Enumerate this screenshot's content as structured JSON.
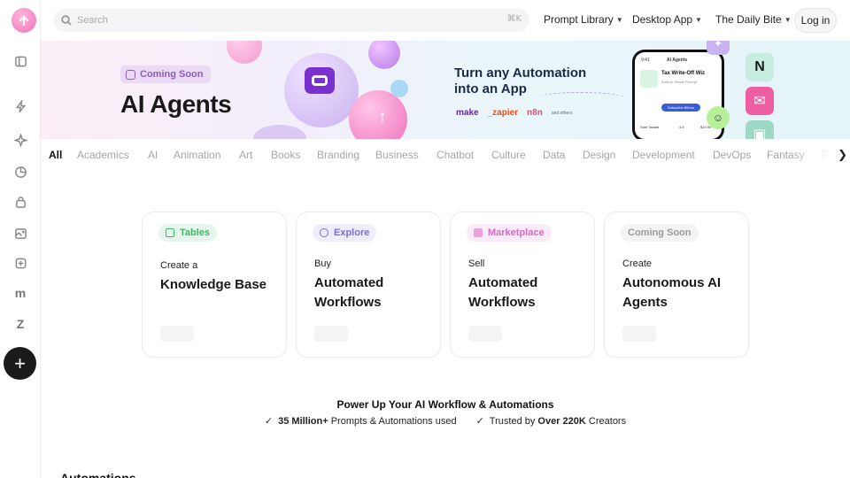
{
  "search": {
    "placeholder": "Search",
    "shortcut": "⌘K"
  },
  "nav": {
    "prompt_library": "Prompt Library",
    "desktop_app": "Desktop App",
    "daily_bite": "The Daily Bite",
    "login": "Log in"
  },
  "sidebar": {
    "items": [
      {
        "icon": "sidebar-panel-icon"
      },
      {
        "icon": "lightning-icon"
      },
      {
        "icon": "sparkle-icon"
      },
      {
        "icon": "chart-pie-icon"
      },
      {
        "icon": "bag-icon"
      },
      {
        "icon": "image-plus-icon"
      },
      {
        "icon": "plugin-icon"
      },
      {
        "icon": "make-logo-icon",
        "text": "m"
      },
      {
        "icon": "zapier-logo-icon",
        "text": "Z"
      }
    ],
    "add_label": "+"
  },
  "banner": {
    "badge": "Coming Soon",
    "title": "AI Agents",
    "headline": "Turn any Automation into an App",
    "brands": [
      "make",
      "_zapier",
      "n8n",
      "and others"
    ],
    "phone": {
      "app": "AI Agents",
      "time": "9:41",
      "item_title": "Tax Write-Off Wiz",
      "item_sub": "Built on Shane Prompt",
      "cta": "Subscribe $9/mo",
      "author": "Sam Tabata",
      "rating": "4.8",
      "price": "$19.9k"
    },
    "colors": {
      "accent": "#8e5cb8"
    }
  },
  "categories": [
    "All",
    "Academics",
    "AI",
    "Animation",
    "Art",
    "Books",
    "Branding",
    "Business",
    "Chatbot",
    "Culture",
    "Data",
    "Design",
    "Development",
    "DevOps",
    "Fantasy",
    "Fo"
  ],
  "cards": [
    {
      "badge": "Tables",
      "badge_color": "#3fb86a",
      "badge_bg": "#e6f6ec",
      "verb": "Create a",
      "object": "Knowledge Base"
    },
    {
      "badge": "Explore",
      "badge_color": "#7b6fd0",
      "badge_bg": "#efedfb",
      "verb": "Buy",
      "object": "Automated Workflows"
    },
    {
      "badge": "Marketplace",
      "badge_color": "#d36bc7",
      "badge_bg": "#fbeaf7",
      "verb": "Sell",
      "object": "Automated Workflows"
    },
    {
      "badge": "Coming Soon",
      "badge_color": "#9a9a9a",
      "badge_bg": "#f3f3f3",
      "verb": "Create",
      "object": "Autonomous AI Agents"
    }
  ],
  "power": {
    "title": "Power Up Your AI Workflow & Automations",
    "stat1_bold": "35 Million+",
    "stat1_rest": " Prompts & Automations used",
    "stat2_pre": "Trusted by ",
    "stat2_bold": "Over 220K",
    "stat2_rest": " Creators"
  },
  "section_peek": "Automations"
}
